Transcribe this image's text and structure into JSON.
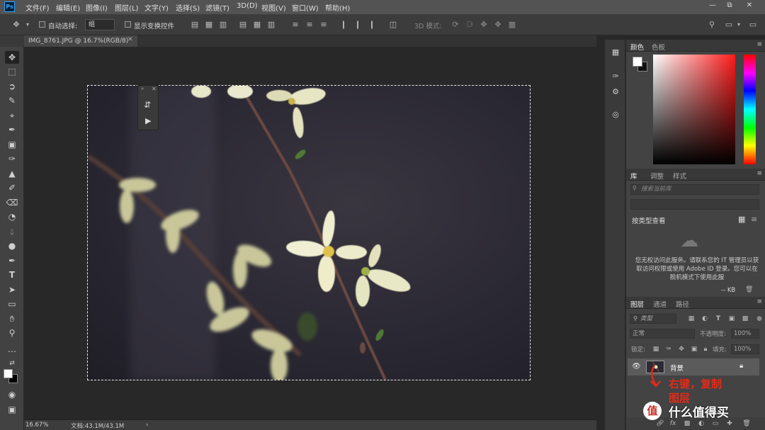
{
  "app": {
    "logo": "Ps"
  },
  "menu": [
    "文件(F)",
    "编辑(E)",
    "图像(I)",
    "图层(L)",
    "文字(Y)",
    "选择(S)",
    "滤镜(T)",
    "3D(D)",
    "视图(V)",
    "窗口(W)",
    "帮助(H)"
  ],
  "options": {
    "auto_select_label": "自动选择:",
    "auto_select_value": "组",
    "transform_label": "显示变换控件",
    "mode_3d_label": "3D 模式:"
  },
  "document": {
    "tab_title": "IMG_8761.JPG @ 16.7%(RGB/8)",
    "zoom": "16.67%",
    "doc_size": "文档:43.1M/43.1M"
  },
  "color_panel": {
    "tabs": [
      "颜色",
      "色板"
    ]
  },
  "library_panel": {
    "tabs": [
      "库",
      "调整",
      "样式"
    ],
    "search_placeholder": "搜索当前库",
    "view_by": "按类型查看",
    "message": "您无权访问此服务。请联系您的 IT 管理员以获取访问权限或使用 Adobe ID 登录。您可以在脱机模式下使用此服",
    "size": "-- KB"
  },
  "layers_panel": {
    "tabs": [
      "图层",
      "通道",
      "路径"
    ],
    "filter_placeholder": "类型",
    "blend_mode": "正常",
    "opacity_label": "不透明度:",
    "opacity_value": "100%",
    "lock_label": "锁定:",
    "fill_label": "填充:",
    "fill_value": "100%",
    "layer_name": "背景"
  },
  "annotation": {
    "line1": "右键，复制",
    "line2": "图层"
  },
  "watermark": "值 什么值得买"
}
